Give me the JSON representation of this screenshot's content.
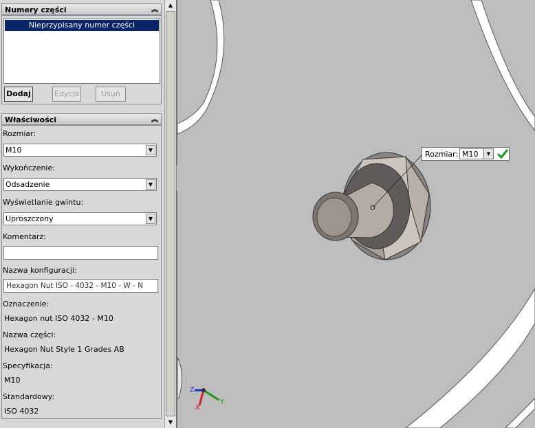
{
  "part_numbers": {
    "title": "Numery części",
    "selected_item": "Nieprzypisany numer części",
    "buttons": {
      "add": "Dodaj",
      "edit": "Edycja",
      "delete": "Usuń"
    }
  },
  "properties": {
    "title": "Właściwości",
    "size_label": "Rozmiar:",
    "size_value": "M10",
    "finish_label": "Wykończenie:",
    "finish_value": "Odsadzenie",
    "thread_label": "Wyświetlanie gwintu:",
    "thread_value": "Uproszczony",
    "comment_label": "Komentarz:",
    "comment_value": "",
    "config_label": "Nazwa konfiguracji:",
    "config_value": "Hexagon Nut ISO - 4032 - M10 - W - N",
    "designation_label": "Oznaczenie:",
    "designation_value": "Hexagon nut ISO 4032 - M10",
    "part_name_label": "Nazwa części:",
    "part_name_value": "Hexagon Nut Style 1 Grades AB",
    "spec_label": "Specyfikacja:",
    "spec_value": "M10",
    "standard_label": "Standardowy:",
    "standard_value": "ISO 4032"
  },
  "viewport": {
    "popup_label": "Rozmiar:",
    "popup_value": "M10",
    "triad": {
      "x": "X",
      "y": "Y",
      "z": "Z"
    },
    "colors": {
      "background": "#bdbdbd",
      "accent_check": "#1a9a1a",
      "selection": "#0a246a"
    }
  }
}
